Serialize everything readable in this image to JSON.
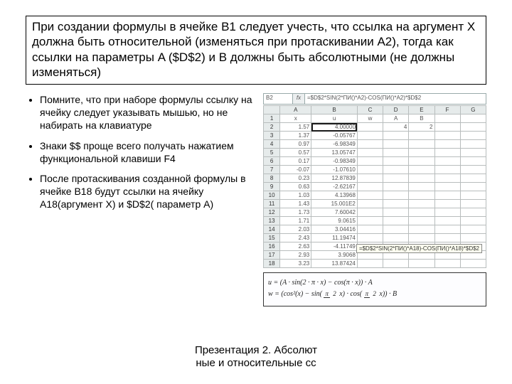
{
  "title": "При создании формулы в ячейке B1  следует учесть, что ссылка на аргумент X должна быть относительной (изменяться при протаскивании  A2), тогда как ссылки на параметры A ($D$2) и B должны быть абсолютными (не должны изменяться)",
  "bullets": [
    "Помните, что при наборе формулы ссылку на ячейку следует указывать мышью, но не набирать на клавиатуре",
    "Знаки $$ проще всего получать нажатием функциональной клавиши F4",
    "После протаскивания созданной формулы в ячейке B18 будут ссылки на ячейку A18(аргумент X) и $D$2( параметр A)"
  ],
  "formula_bar": {
    "name": "B2",
    "fx": "fx",
    "formula": "=$D$2*SIN(2*ПИ()*A2)-COS(ПИ()*A2)*$D$2"
  },
  "headers": [
    "",
    "A",
    "B",
    "C",
    "D",
    "E",
    "F",
    "G"
  ],
  "label_row": {
    "row": "1",
    "cells": [
      "x",
      "u",
      "w",
      "A",
      "B",
      "",
      ""
    ]
  },
  "rows": [
    {
      "row": "2",
      "cells": [
        "1.57",
        "4.00000",
        "",
        "4",
        "2",
        "",
        ""
      ]
    },
    {
      "row": "3",
      "cells": [
        "1.37",
        "-0.05767",
        "",
        "",
        "",
        "",
        ""
      ]
    },
    {
      "row": "4",
      "cells": [
        "0.97",
        "-6.98349",
        "",
        "",
        "",
        "",
        ""
      ]
    },
    {
      "row": "5",
      "cells": [
        "0.57",
        "13.05747",
        "",
        "",
        "",
        "",
        ""
      ]
    },
    {
      "row": "6",
      "cells": [
        "0.17",
        "-0.98349",
        "",
        "",
        "",
        "",
        ""
      ]
    },
    {
      "row": "7",
      "cells": [
        "-0.07",
        "-1.07610",
        "",
        "",
        "",
        "",
        ""
      ]
    },
    {
      "row": "8",
      "cells": [
        "0.23",
        "12.87839",
        "",
        "",
        "",
        "",
        ""
      ]
    },
    {
      "row": "9",
      "cells": [
        "0.63",
        "-2.62167",
        "",
        "",
        "",
        "",
        ""
      ]
    },
    {
      "row": "10",
      "cells": [
        "1.03",
        "4.13968",
        "",
        "",
        "",
        "",
        ""
      ]
    },
    {
      "row": "11",
      "cells": [
        "1.43",
        "15.001E2",
        "",
        "",
        "",
        "",
        ""
      ]
    },
    {
      "row": "12",
      "cells": [
        "1.73",
        "7.60042",
        "",
        "",
        "",
        "",
        ""
      ]
    },
    {
      "row": "13",
      "cells": [
        "1.71",
        "9.0615",
        "",
        "",
        "",
        "",
        ""
      ]
    },
    {
      "row": "14",
      "cells": [
        "2.03",
        "3.04416",
        "",
        "",
        "",
        "",
        ""
      ]
    },
    {
      "row": "15",
      "cells": [
        "2.43",
        "11.19474",
        "",
        "",
        "",
        "",
        ""
      ]
    },
    {
      "row": "16",
      "cells": [
        "2.63",
        "-4.11749",
        "",
        "",
        "",
        "",
        ""
      ]
    },
    {
      "row": "17",
      "cells": [
        "2.93",
        "3.9068",
        "",
        "",
        "",
        "",
        ""
      ]
    },
    {
      "row": "18",
      "cells": [
        "3.23",
        "13.87424",
        "",
        "",
        "",
        "",
        ""
      ]
    }
  ],
  "tooltip": "=$D$2*SIN(2*ПИ()*A18)-COS(ПИ()*A18)*$D$2",
  "equation_u_prefix": "u = (A · sin(2 · π · x) − cos(π · x)) · A",
  "equation_w_parts": {
    "lead": "w = (cos²(x) − sin(",
    "num": "π",
    "den": "2",
    "mid": " x) · cos(",
    "num2": "π",
    "den2": "2",
    "tail": " x)) · B"
  },
  "footer_line1": "Презентация 2. Абсолют",
  "footer_line2": "ные и относительные сс"
}
